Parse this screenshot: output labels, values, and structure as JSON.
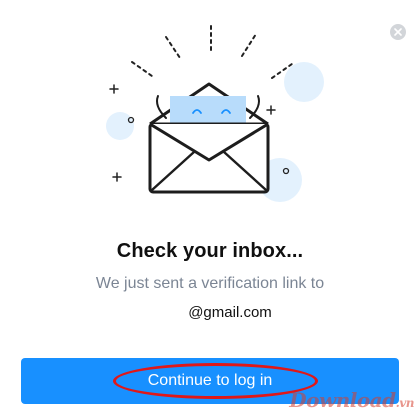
{
  "dialog": {
    "title": "Check your inbox...",
    "subtitle": "We just sent a verification link to",
    "email": "@gmail.com",
    "primary_button_label": "Continue to log in",
    "close_icon": "close-icon",
    "illustration_icon": "open-envelope-icon"
  },
  "watermark": {
    "name": "Download",
    "tld": ".vn"
  },
  "colors": {
    "accent": "#1890ff",
    "title_text": "#101010",
    "subtitle_text": "#7b8594",
    "highlight": "#e01818",
    "letter_fill": "#b8dcfb",
    "bubble": "#e3f1fd"
  }
}
